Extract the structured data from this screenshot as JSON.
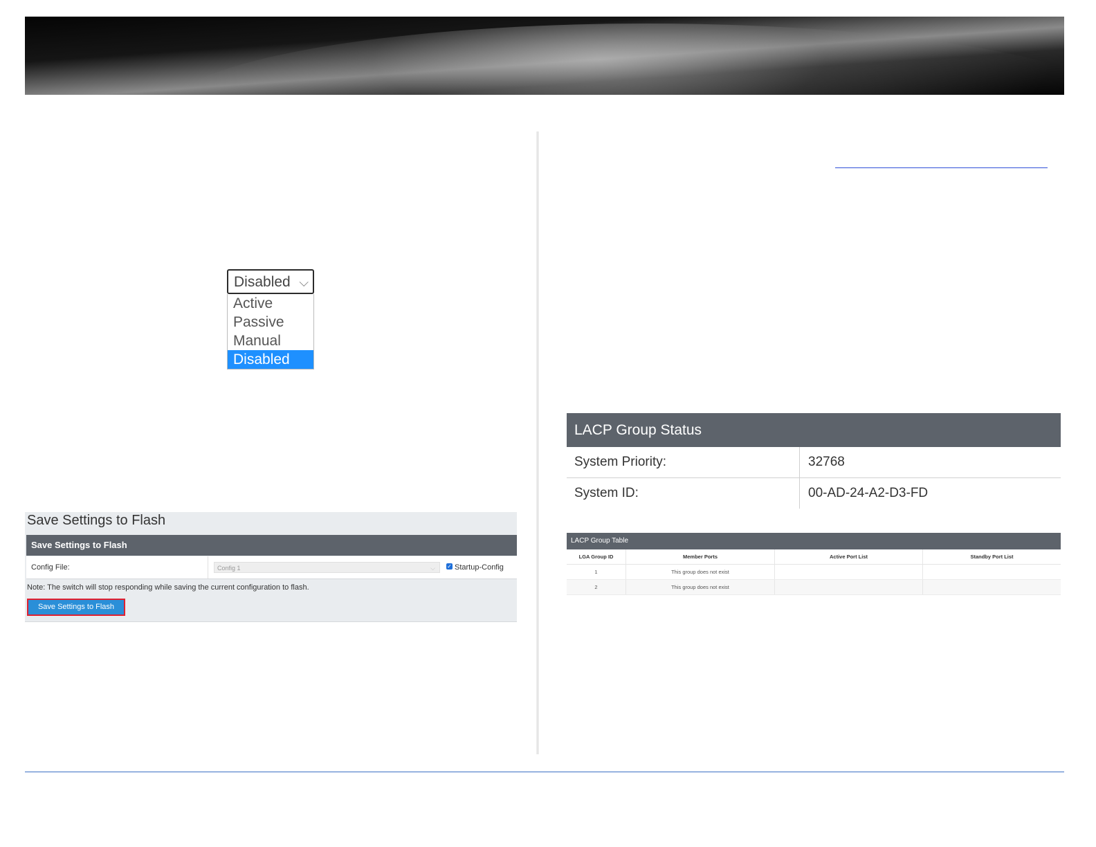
{
  "dropdown": {
    "selected": "Disabled",
    "options": [
      "Active",
      "Passive",
      "Manual",
      "Disabled"
    ]
  },
  "save_settings": {
    "title": "Save Settings to Flash",
    "bar_title": "Save Settings to Flash",
    "config_file_label": "Config File:",
    "config_file_value": "Config 1",
    "startup_config_label": "Startup-Config",
    "note": "Note: The switch will stop responding while saving the current configuration to flash.",
    "button_label": "Save Settings to Flash"
  },
  "lacp_status": {
    "title": "LACP Group Status",
    "rows": [
      {
        "label": "System Priority:",
        "value": "32768"
      },
      {
        "label": "System ID:",
        "value": "00-AD-24-A2-D3-FD"
      }
    ]
  },
  "lacp_table": {
    "title": "LACP Group Table",
    "columns": [
      "LGA Group ID",
      "Member Ports",
      "Active Port List",
      "Standby Port List"
    ],
    "rows": [
      [
        "1",
        "This group does not exist",
        "",
        ""
      ],
      [
        "2",
        "This group does not exist",
        "",
        ""
      ]
    ]
  },
  "colors": {
    "header_bar": "#5d636b",
    "selected_option": "#1e90ff",
    "button": "#2a8fd8",
    "button_highlight": "#e02030",
    "footer_rule": "#3b6fc4"
  }
}
